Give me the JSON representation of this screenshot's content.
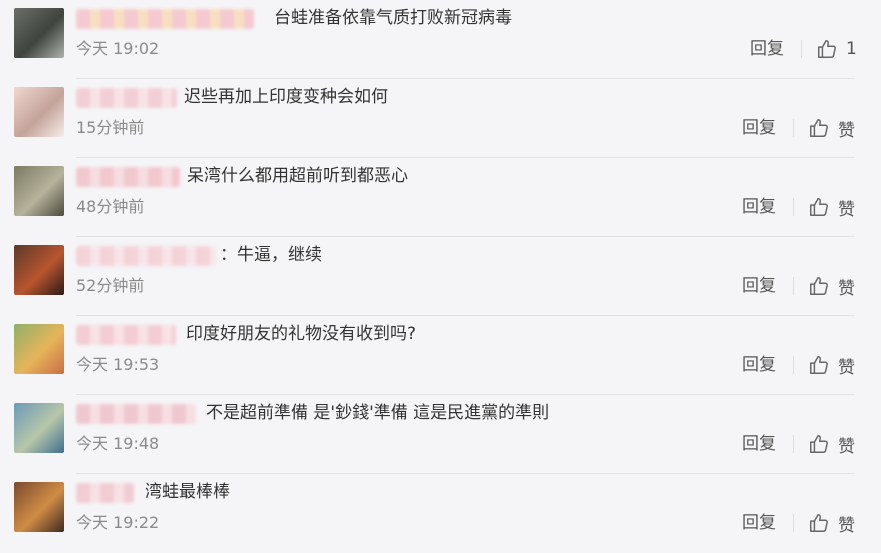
{
  "comments": [
    {
      "text": "台蛙准备依靠气质打败新冠病毒",
      "time": "今天 19:02",
      "reply": "回复",
      "like": "1",
      "colors": {
        "avatar": [
          "#6b6f68",
          "#40443f",
          "#aeb3ad"
        ],
        "name": [
          "#f5c9d1",
          "#f7e0c0"
        ]
      }
    },
    {
      "text": "迟些再加上印度变种会如何",
      "time": "15分钟前",
      "reply": "回复",
      "like": "赞",
      "colors": {
        "avatar": [
          "#f0d7cf",
          "#c3a39a",
          "#f7ece8"
        ],
        "name": [
          "#f2cfd6",
          "#f7e3e6"
        ]
      }
    },
    {
      "text": "呆湾什么都用超前听到都恶心",
      "time": "48分钟前",
      "reply": "回复",
      "like": "赞",
      "colors": {
        "avatar": [
          "#7b7a62",
          "#b6b29c",
          "#4d4b3d"
        ],
        "name": [
          "#f2c8cf",
          "#f6dde2"
        ]
      }
    },
    {
      "text": "：牛逼，继续",
      "time": "52分钟前",
      "reply": "回复",
      "like": "赞",
      "colors": {
        "avatar": [
          "#5a3a2b",
          "#b8552e",
          "#2b1b14"
        ],
        "name": [
          "#f3d2d8",
          "#f7e6e9"
        ]
      }
    },
    {
      "text": "印度好朋友的礼物没有收到吗?",
      "time": "今天 19:53",
      "reply": "回复",
      "like": "赞",
      "colors": {
        "avatar": [
          "#8fb06a",
          "#e6b45a",
          "#c96e45"
        ],
        "name": [
          "#f3cdd3",
          "#f7e2e5"
        ]
      }
    },
    {
      "text": "不是超前準備 是'鈔錢'準備 這是民進黨的準則",
      "time": "今天 19:48",
      "reply": "回复",
      "like": "赞",
      "colors": {
        "avatar": [
          "#6c9ab8",
          "#b7c6a8",
          "#3f6e8f"
        ],
        "name": [
          "#efc7cf",
          "#f5dfe3"
        ]
      }
    },
    {
      "text": "湾蛙最棒棒",
      "time": "今天 19:22",
      "reply": "回复",
      "like": "赞",
      "colors": {
        "avatar": [
          "#7a4b2e",
          "#d08c45",
          "#3b2a1f"
        ],
        "name": [
          "#f2ccd3",
          "#f6e1e5"
        ]
      }
    }
  ]
}
